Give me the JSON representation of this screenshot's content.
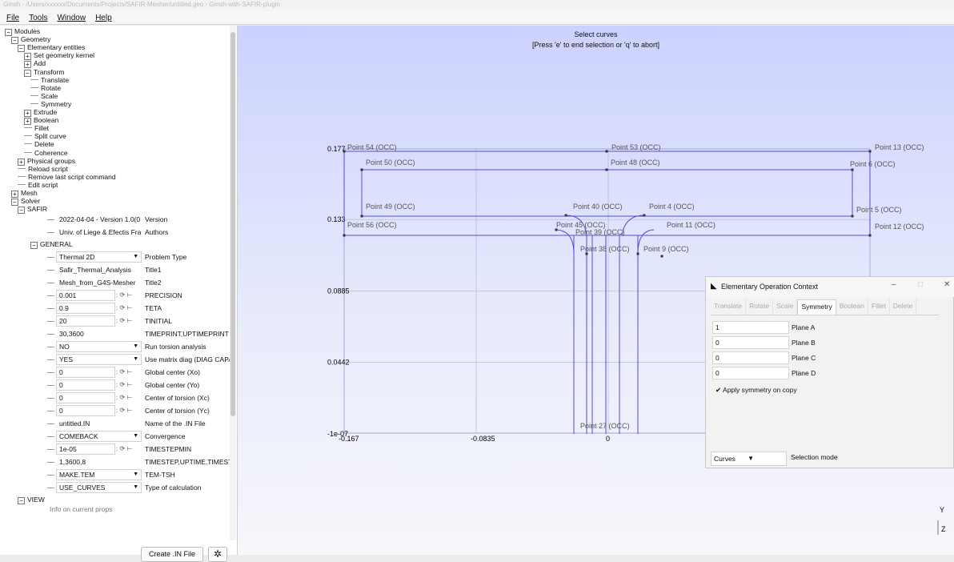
{
  "window": {
    "title": "Gmsh - /Users/xxxxxx/Documents/Projects/SAFIR-Mesher/untitled.geo - Gmsh-with-SAFIR-plugin"
  },
  "menu": [
    "File",
    "Tools",
    "Window",
    "Help"
  ],
  "tree": [
    {
      "label": "Modules",
      "toggle": "−",
      "indent": 0
    },
    {
      "label": "Geometry",
      "toggle": "−",
      "indent": 1
    },
    {
      "label": "Elementary entities",
      "toggle": "−",
      "indent": 2
    },
    {
      "label": "Set geometry kernel",
      "toggle": "+",
      "indent": 3
    },
    {
      "label": "Add",
      "toggle": "+",
      "indent": 3
    },
    {
      "label": "Transform",
      "toggle": "−",
      "indent": 3
    },
    {
      "label": "Translate",
      "toggle": "",
      "indent": 4
    },
    {
      "label": "Rotate",
      "toggle": "",
      "indent": 4
    },
    {
      "label": "Scale",
      "toggle": "",
      "indent": 4
    },
    {
      "label": "Symmetry",
      "toggle": "",
      "indent": 4
    },
    {
      "label": "Extrude",
      "toggle": "+",
      "indent": 3
    },
    {
      "label": "Boolean",
      "toggle": "+",
      "indent": 3
    },
    {
      "label": "Fillet",
      "toggle": "",
      "indent": 3
    },
    {
      "label": "Split curve",
      "toggle": "",
      "indent": 3
    },
    {
      "label": "Delete",
      "toggle": "",
      "indent": 3
    },
    {
      "label": "Coherence",
      "toggle": "",
      "indent": 3
    },
    {
      "label": "Physical groups",
      "toggle": "+",
      "indent": 2
    },
    {
      "label": "Reload script",
      "toggle": "",
      "indent": 2
    },
    {
      "label": "Remove last script command",
      "toggle": "",
      "indent": 2
    },
    {
      "label": "Edit script",
      "toggle": "",
      "indent": 2
    },
    {
      "label": "Mesh",
      "toggle": "+",
      "indent": 1
    },
    {
      "label": "Solver",
      "toggle": "−",
      "indent": 1
    },
    {
      "label": "SAFIR",
      "toggle": "−",
      "indent": 2
    }
  ],
  "safir_info": [
    {
      "value": "2022-04-04 - Version 1.0(0",
      "label": "Version"
    },
    {
      "value": "Univ. of Liege & Efectis Fra",
      "label": "Authors"
    }
  ],
  "general_label": "GENERAL",
  "view_label": "VIEW",
  "view_child": "Info on current props",
  "params": [
    {
      "value": "Thermal 2D",
      "kind": "dd",
      "label": "Problem Type"
    },
    {
      "value": "Safir_Thermal_Analysis",
      "kind": "tx",
      "label": "Title1"
    },
    {
      "value": "Mesh_from_G4S-Mesher",
      "kind": "tx",
      "label": "Title2"
    },
    {
      "value": "0.001",
      "kind": "sp",
      "label": "PRECISION"
    },
    {
      "value": "0.9",
      "kind": "sp",
      "label": "TETA"
    },
    {
      "value": "20",
      "kind": "sp",
      "label": "TINITIAL"
    },
    {
      "value": "30,3600",
      "kind": "tx",
      "label": "TIMEPRINT,UPTIMEPRINT"
    },
    {
      "value": "NO",
      "kind": "dd",
      "label": "Run torsion analysis"
    },
    {
      "value": "YES",
      "kind": "dd",
      "label": "Use matrix diag (DIAG CAPA)"
    },
    {
      "value": "0",
      "kind": "sp",
      "label": "Global center (Xo)"
    },
    {
      "value": "0",
      "kind": "sp",
      "label": "Global center (Yo)"
    },
    {
      "value": "0",
      "kind": "sp",
      "label": "Center of torsion (Xc)"
    },
    {
      "value": "0",
      "kind": "sp",
      "label": "Center of torsion (Yc)"
    },
    {
      "value": "untitled.IN",
      "kind": "tx",
      "label": "Name of the .IN File"
    },
    {
      "value": "COMEBACK",
      "kind": "dd",
      "label": "Convergence"
    },
    {
      "value": "1e-05",
      "kind": "sp",
      "label": "TIMESTEPMIN"
    },
    {
      "value": "1,3600,8",
      "kind": "tx",
      "label": "TIMESTEP,UPTIME,TIMESTEPMAX"
    },
    {
      "value": "MAKE.TEM",
      "kind": "dd",
      "label": "TEM-TSH"
    },
    {
      "value": "USE_CURVES",
      "kind": "dd",
      "label": "Type of calculation"
    }
  ],
  "buttons": {
    "create": "Create .IN File"
  },
  "status": {
    "line1": "Select curves",
    "line2": "[Press 'e' to end selection or 'q' to abort]"
  },
  "axes": {
    "y_ticks": [
      {
        "label": "0.177",
        "value": 0.177
      },
      {
        "label": "0.133",
        "value": 0.133
      },
      {
        "label": "0.0885",
        "value": 0.0885
      },
      {
        "label": "0.0442",
        "value": 0.0442
      },
      {
        "label": "-1e-07",
        "value": -1e-07
      }
    ],
    "x_ticks": [
      {
        "label": "-0.167",
        "value": -0.167
      },
      {
        "label": "-0.0835",
        "value": -0.0835
      },
      {
        "label": "0",
        "value": 0
      }
    ],
    "triad": [
      "Y",
      "Z"
    ]
  },
  "point_labels": [
    "Point 54 (OCC)",
    "Point 53 (OCC)",
    "Point 13 (OCC)",
    "Point 50 (OCC)",
    "Point 48 (OCC)",
    "Point 6 (OCC)",
    "Point 49 (OCC)",
    "Point 40 (OCC)",
    "Point 4 (OCC)",
    "Point 5 (OCC)",
    "Point 56 (OCC)",
    "Point 45 (OCC)",
    "Point 39 (OCC)",
    "Point 11 (OCC)",
    "Point 12 (OCC)",
    "Point 38 (OCC)",
    "Point 9 (OCC)",
    "Point 27 (OCC)"
  ],
  "dialog": {
    "title": "Elementary Operation Context",
    "tabs": [
      "Translate",
      "Rotate",
      "Scale",
      "Symmetry",
      "Boolean",
      "Fillet",
      "Delete"
    ],
    "active_tab": "Symmetry",
    "fields": [
      {
        "value": "1",
        "label": "Plane A"
      },
      {
        "value": "0",
        "label": "Plane B"
      },
      {
        "value": "0",
        "label": "Plane C"
      },
      {
        "value": "0",
        "label": "Plane D"
      }
    ],
    "apply": "Apply symmetry on copy",
    "selection_value": "Curves",
    "selection_label": "Selection mode"
  }
}
